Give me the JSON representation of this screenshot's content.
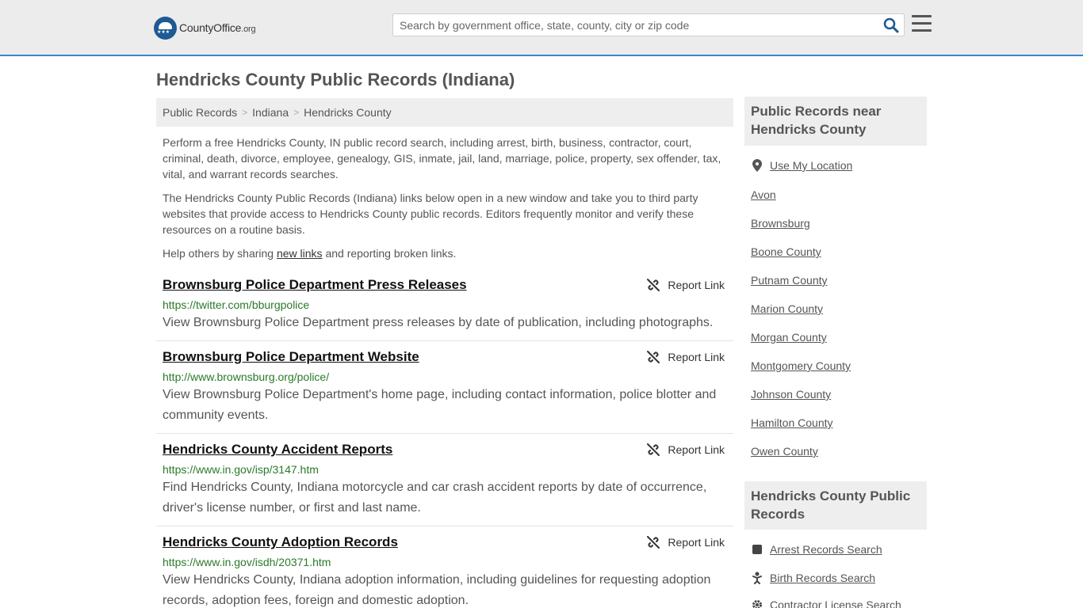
{
  "header": {
    "logo_main": "CountyOffice",
    "logo_org": ".org",
    "search_placeholder": "Search by government office, state, county, city or zip code"
  },
  "page": {
    "title": "Hendricks County Public Records (Indiana)"
  },
  "breadcrumb": [
    "Public Records",
    "Indiana",
    "Hendricks County"
  ],
  "intro": {
    "p1": "Perform a free Hendricks County, IN public record search, including arrest, birth, business, contractor, court, criminal, death, divorce, employee, genealogy, GIS, inmate, jail, land, marriage, police, property, sex offender, tax, vital, and warrant records searches.",
    "p2": "The Hendricks County Public Records (Indiana) links below open in a new window and take you to third party websites that provide access to Hendricks County public records. Editors frequently monitor and verify these resources on a routine basis.",
    "p3_before": "Help others by sharing ",
    "p3_link": "new links",
    "p3_after": " and reporting broken links."
  },
  "report_label": "Report Link",
  "items": [
    {
      "title": "Brownsburg Police Department Press Releases",
      "url": "https://twitter.com/bburgpolice",
      "desc": "View Brownsburg Police Department press releases by date of publication, including photographs."
    },
    {
      "title": "Brownsburg Police Department Website",
      "url": "http://www.brownsburg.org/police/",
      "desc": "View Brownsburg Police Department's home page, including contact information, police blotter and community events."
    },
    {
      "title": "Hendricks County Accident Reports",
      "url": "https://www.in.gov/isp/3147.htm",
      "desc": "Find Hendricks County, Indiana motorcycle and car crash accident reports by date of occurrence, driver's license number, or first and last name."
    },
    {
      "title": "Hendricks County Adoption Records",
      "url": "https://www.in.gov/isdh/20371.htm",
      "desc": "View Hendricks County, Indiana adoption information, including guidelines for requesting adoption records, adoption fees, foreign and domestic adoption."
    }
  ],
  "sidebar": {
    "nearby_heading": "Public Records near Hendricks County",
    "use_location": "Use My Location",
    "nearby": [
      "Avon",
      "Brownsburg",
      "Boone County",
      "Putnam County",
      "Marion County",
      "Morgan County",
      "Montgomery County",
      "Johnson County",
      "Hamilton County",
      "Owen County"
    ],
    "records_heading": "Hendricks County Public Records",
    "records": [
      {
        "label": "Arrest Records Search",
        "icon": "arrest-icon"
      },
      {
        "label": "Birth Records Search",
        "icon": "baby-icon"
      },
      {
        "label": "Contractor License Search",
        "icon": "gear-icon"
      }
    ]
  }
}
